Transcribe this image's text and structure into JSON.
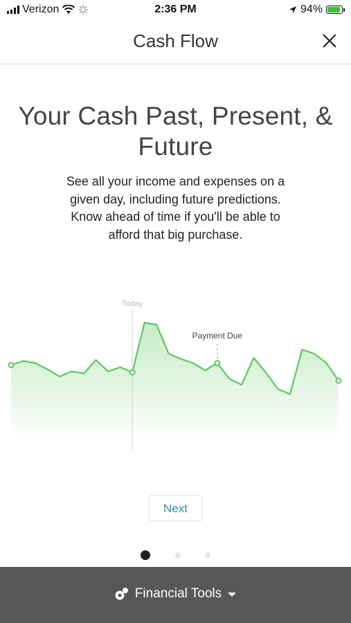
{
  "status_bar": {
    "carrier": "Verizon",
    "time": "2:36 PM",
    "battery_percent": "94%",
    "battery_level": 0.94,
    "battery_color": "#3cc13b"
  },
  "header": {
    "title": "Cash Flow",
    "close_icon": "close-icon"
  },
  "hero": {
    "title": "Your Cash Past, Present, & Future",
    "description": "See all your income and expenses on a given day, including future predictions. Know ahead of time if you'll be able to afford that big purchase."
  },
  "chart_data": {
    "type": "area",
    "line_color": "#5cc760",
    "fill_color": "#d4f1d4",
    "today_label": "Today",
    "annotation": "Payment Due",
    "today_index": 10,
    "payment_due_index": 17,
    "values": [
      45,
      49,
      47,
      41,
      34,
      39,
      37,
      50,
      39,
      43,
      38,
      86,
      84,
      56,
      51,
      47,
      40,
      47,
      32,
      26,
      52,
      38,
      22,
      17,
      60,
      56,
      47,
      30
    ],
    "ylim": [
      0,
      100
    ]
  },
  "actions": {
    "next_label": "Next"
  },
  "pager": {
    "pages": 3,
    "current": 1
  },
  "bottom_bar": {
    "label": "Financial Tools",
    "icon": "financial-tools-icon",
    "chevron": "chevron-down-icon"
  }
}
